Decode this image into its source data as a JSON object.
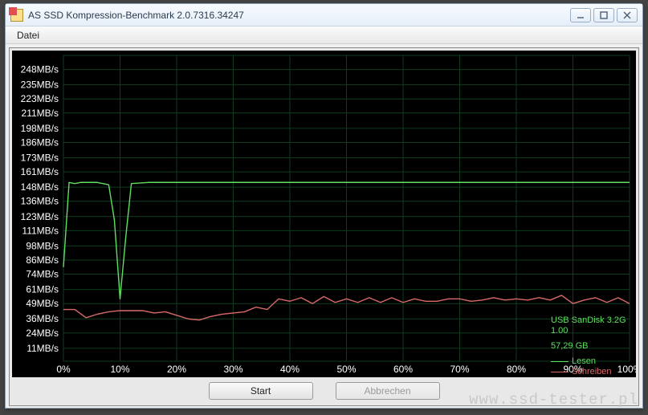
{
  "window": {
    "title": "AS SSD Kompression-Benchmark 2.0.7316.34247"
  },
  "menu": {
    "datei": "Datei"
  },
  "buttons": {
    "start": "Start",
    "abbrechen": "Abbrechen"
  },
  "info": {
    "device_line1": "USB  SanDisk 3.2G",
    "device_line2": "1.00",
    "capacity": "57,29 GB"
  },
  "legend": {
    "lesen": "Lesen",
    "schreiben": "Schreiben"
  },
  "watermark": "www.ssd-tester.pl",
  "chart_data": {
    "type": "line",
    "title": "",
    "xlabel": "",
    "ylabel": "",
    "x_unit": "%",
    "y_unit": "MB/s",
    "ylim": [
      0,
      260
    ],
    "xlim": [
      0,
      100
    ],
    "y_ticks": [
      11,
      24,
      36,
      49,
      61,
      74,
      86,
      98,
      111,
      123,
      136,
      148,
      161,
      173,
      186,
      198,
      211,
      223,
      235,
      248
    ],
    "y_tick_labels": [
      "11MB/s",
      "24MB/s",
      "36MB/s",
      "49MB/s",
      "61MB/s",
      "74MB/s",
      "86MB/s",
      "98MB/s",
      "111MB/s",
      "123MB/s",
      "136MB/s",
      "148MB/s",
      "161MB/s",
      "173MB/s",
      "186MB/s",
      "198MB/s",
      "211MB/s",
      "223MB/s",
      "235MB/s",
      "248MB/s"
    ],
    "x_ticks": [
      0,
      10,
      20,
      30,
      40,
      50,
      60,
      70,
      80,
      90,
      100
    ],
    "x_tick_labels": [
      "0%",
      "10%",
      "20%",
      "30%",
      "40%",
      "50%",
      "60%",
      "70%",
      "80%",
      "90%",
      "100%"
    ],
    "grid": true,
    "legend_position": "right",
    "series": [
      {
        "name": "Lesen",
        "color": "#5fe05f",
        "x": [
          0,
          1,
          2,
          3,
          4,
          5,
          6,
          7,
          8,
          9,
          10,
          11,
          12,
          15,
          20,
          25,
          30,
          35,
          40,
          45,
          50,
          55,
          60,
          65,
          70,
          75,
          80,
          85,
          90,
          95,
          100
        ],
        "y": [
          80,
          152,
          151,
          152,
          152,
          152,
          152,
          151,
          150,
          120,
          53,
          105,
          151,
          152,
          152,
          152,
          152,
          152,
          152,
          152,
          152,
          152,
          152,
          152,
          152,
          152,
          152,
          152,
          152,
          152,
          152
        ]
      },
      {
        "name": "Schreiben",
        "color": "#d86a6a",
        "x": [
          0,
          2,
          4,
          6,
          8,
          10,
          12,
          14,
          16,
          18,
          20,
          22,
          24,
          26,
          28,
          30,
          32,
          34,
          36,
          38,
          40,
          42,
          44,
          46,
          48,
          50,
          52,
          54,
          56,
          58,
          60,
          62,
          64,
          66,
          68,
          70,
          72,
          74,
          76,
          78,
          80,
          82,
          84,
          86,
          88,
          90,
          92,
          94,
          96,
          98,
          100
        ],
        "y": [
          44,
          44,
          37,
          40,
          42,
          43,
          43,
          43,
          41,
          42,
          39,
          36,
          35,
          38,
          40,
          41,
          42,
          46,
          44,
          53,
          51,
          54,
          49,
          55,
          50,
          53,
          50,
          54,
          50,
          54,
          50,
          53,
          51,
          51,
          53,
          53,
          51,
          52,
          54,
          52,
          53,
          52,
          54,
          52,
          56,
          49,
          52,
          54,
          50,
          54,
          49
        ]
      }
    ]
  }
}
